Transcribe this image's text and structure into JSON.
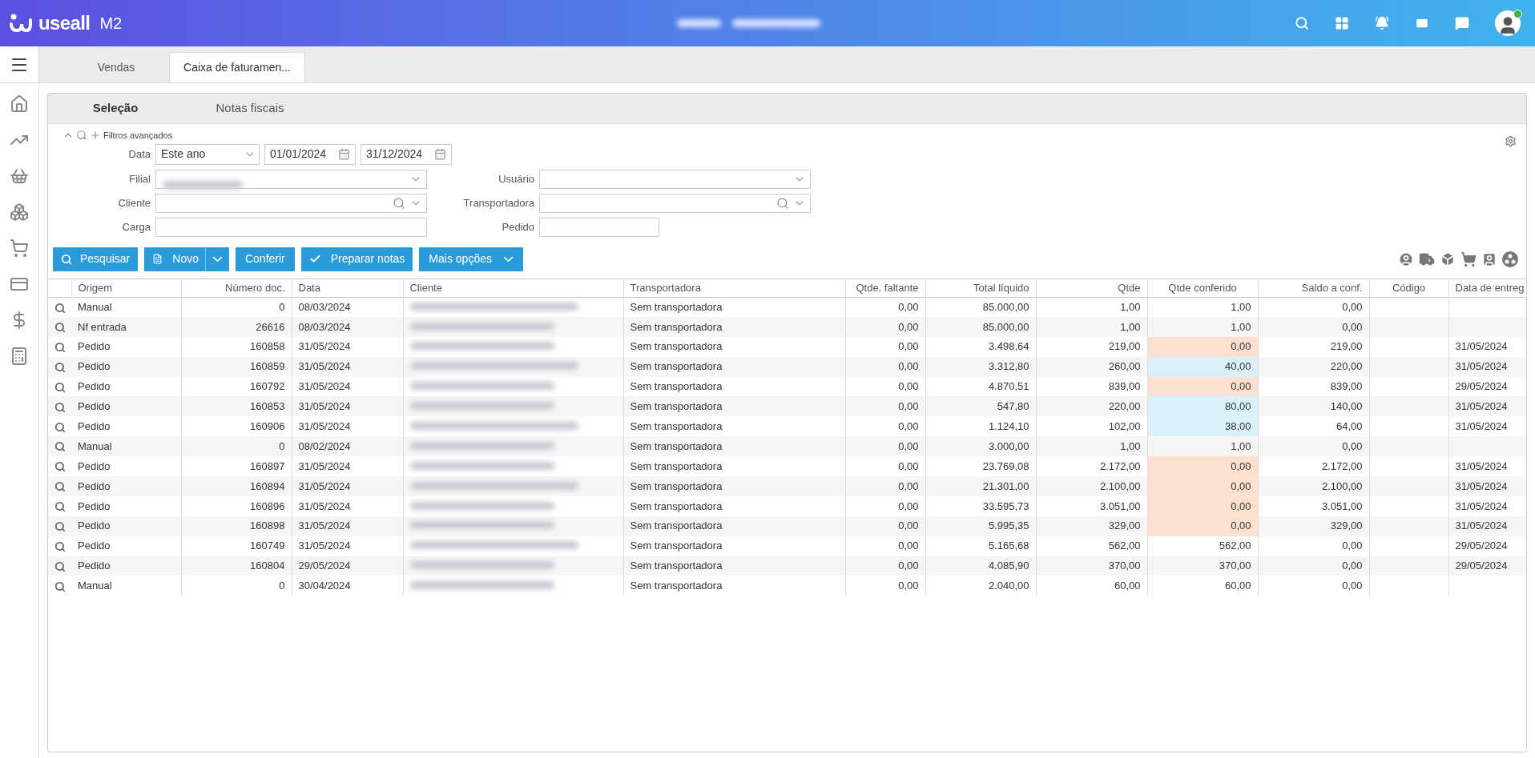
{
  "header": {
    "logo_text": "useall",
    "logo_suffix": "M2"
  },
  "tabs": [
    {
      "label": "Vendas",
      "selected": false
    },
    {
      "label": "Caixa de faturamen...",
      "selected": true
    }
  ],
  "sub_tabs": [
    {
      "label": "Seleção",
      "selected": true
    },
    {
      "label": "Notas fiscais",
      "selected": false
    }
  ],
  "filters": {
    "toggle_label": "Filtros avançados",
    "data_label": "Data",
    "period": "Este ano",
    "date_from": "01/01/2024",
    "date_to": "31/12/2024",
    "left": [
      {
        "label": "Filial",
        "kind": "select"
      },
      {
        "label": "Cliente",
        "kind": "search"
      },
      {
        "label": "Carga",
        "kind": "text"
      }
    ],
    "right": [
      {
        "label": "Usuário",
        "kind": "select"
      },
      {
        "label": "Transportadora",
        "kind": "search"
      },
      {
        "label": "Pedido",
        "kind": "short"
      }
    ]
  },
  "buttons": [
    {
      "label": "Pesquisar",
      "kind": "search"
    },
    {
      "label": "Novo",
      "kind": "split"
    },
    {
      "label": "Conferir",
      "kind": "plain"
    },
    {
      "label": "Preparar notas",
      "kind": "check"
    },
    {
      "label": "Mais opções",
      "kind": "dropdown"
    }
  ],
  "table": {
    "columns": [
      "Origem",
      "Número doc.",
      "Data",
      "Cliente",
      "Transportadora",
      "Qtde. faltante",
      "Total líquido",
      "Qtde",
      "Qtde conferido",
      "Saldo a conf.",
      "Código",
      "Data de entreg"
    ],
    "rows": [
      {
        "origem": "Manual",
        "numero": "0",
        "data": "08/03/2024",
        "transportadora": "Sem transportadora",
        "faltante": "0,00",
        "total": "85.000,00",
        "qtde": "1,00",
        "conferido": "1,00",
        "saldo": "0,00"
      },
      {
        "origem": "Nf entrada",
        "numero": "26616",
        "data": "08/03/2024",
        "transportadora": "Sem transportadora",
        "faltante": "0,00",
        "total": "85.000,00",
        "qtde": "1,00",
        "conferido": "1,00",
        "saldo": "0,00"
      },
      {
        "color": "#fce0d0",
        "origem": "Pedido",
        "numero": "160858",
        "data": "31/05/2024",
        "transportadora": "Sem transportadora",
        "faltante": "0,00",
        "total": "3.498,64",
        "qtde": "219,00",
        "conferido": "0,00",
        "saldo": "219,00",
        "entrega": "31/05/2024"
      },
      {
        "color": "#dbf1fa",
        "origem": "Pedido",
        "numero": "160859",
        "data": "31/05/2024",
        "transportadora": "Sem transportadora",
        "faltante": "0,00",
        "total": "3.312,80",
        "qtde": "260,00",
        "conferido": "40,00",
        "saldo": "220,00",
        "entrega": "31/05/2024"
      },
      {
        "color": "#fce0d0",
        "origem": "Pedido",
        "numero": "160792",
        "data": "31/05/2024",
        "transportadora": "Sem transportadora",
        "faltante": "0,00",
        "total": "4.870,51",
        "qtde": "839,00",
        "conferido": "0,00",
        "saldo": "839,00",
        "entrega": "29/05/2024"
      },
      {
        "color": "#dbf1fa",
        "origem": "Pedido",
        "numero": "160853",
        "data": "31/05/2024",
        "transportadora": "Sem transportadora",
        "faltante": "0,00",
        "total": "547,80",
        "qtde": "220,00",
        "conferido": "80,00",
        "saldo": "140,00",
        "entrega": "31/05/2024"
      },
      {
        "color": "#dbf1fa",
        "origem": "Pedido",
        "numero": "160906",
        "data": "31/05/2024",
        "transportadora": "Sem transportadora",
        "faltante": "0,00",
        "total": "1.124,10",
        "qtde": "102,00",
        "conferido": "38,00",
        "saldo": "64,00",
        "entrega": "31/05/2024"
      },
      {
        "origem": "Manual",
        "numero": "0",
        "data": "08/02/2024",
        "transportadora": "Sem transportadora",
        "faltante": "0,00",
        "total": "3.000,00",
        "qtde": "1,00",
        "conferido": "1,00",
        "saldo": "0,00"
      },
      {
        "color": "#fce0d0",
        "origem": "Pedido",
        "numero": "160897",
        "data": "31/05/2024",
        "transportadora": "Sem transportadora",
        "faltante": "0,00",
        "total": "23.769,08",
        "qtde": "2.172,00",
        "conferido": "0,00",
        "saldo": "2.172,00",
        "entrega": "31/05/2024"
      },
      {
        "color": "#fce0d0",
        "origem": "Pedido",
        "numero": "160894",
        "data": "31/05/2024",
        "transportadora": "Sem transportadora",
        "faltante": "0,00",
        "total": "21.301,00",
        "qtde": "2.100,00",
        "conferido": "0,00",
        "saldo": "2.100,00",
        "entrega": "31/05/2024"
      },
      {
        "color": "#fce0d0",
        "origem": "Pedido",
        "numero": "160896",
        "data": "31/05/2024",
        "transportadora": "Sem transportadora",
        "faltante": "0,00",
        "total": "33.595,73",
        "qtde": "3.051,00",
        "conferido": "0,00",
        "saldo": "3.051,00",
        "entrega": "31/05/2024"
      },
      {
        "color": "#fce0d0",
        "origem": "Pedido",
        "numero": "160898",
        "data": "31/05/2024",
        "transportadora": "Sem transportadora",
        "faltante": "0,00",
        "total": "5.995,35",
        "qtde": "329,00",
        "conferido": "0,00",
        "saldo": "329,00",
        "entrega": "31/05/2024"
      },
      {
        "origem": "Pedido",
        "numero": "160749",
        "data": "31/05/2024",
        "transportadora": "Sem transportadora",
        "faltante": "0,00",
        "total": "5.165,68",
        "qtde": "562,00",
        "conferido": "562,00",
        "saldo": "0,00",
        "entrega": "29/05/2024"
      },
      {
        "origem": "Pedido",
        "numero": "160804",
        "data": "29/05/2024",
        "transportadora": "Sem transportadora",
        "faltante": "0,00",
        "total": "4.085,90",
        "qtde": "370,00",
        "conferido": "370,00",
        "saldo": "0,00",
        "entrega": "29/05/2024"
      },
      {
        "origem": "Manual",
        "numero": "0",
        "data": "30/04/2024",
        "transportadora": "Sem transportadora",
        "faltante": "0,00",
        "total": "2.040,00",
        "qtde": "60,00",
        "conferido": "60,00",
        "saldo": "0,00"
      }
    ]
  }
}
